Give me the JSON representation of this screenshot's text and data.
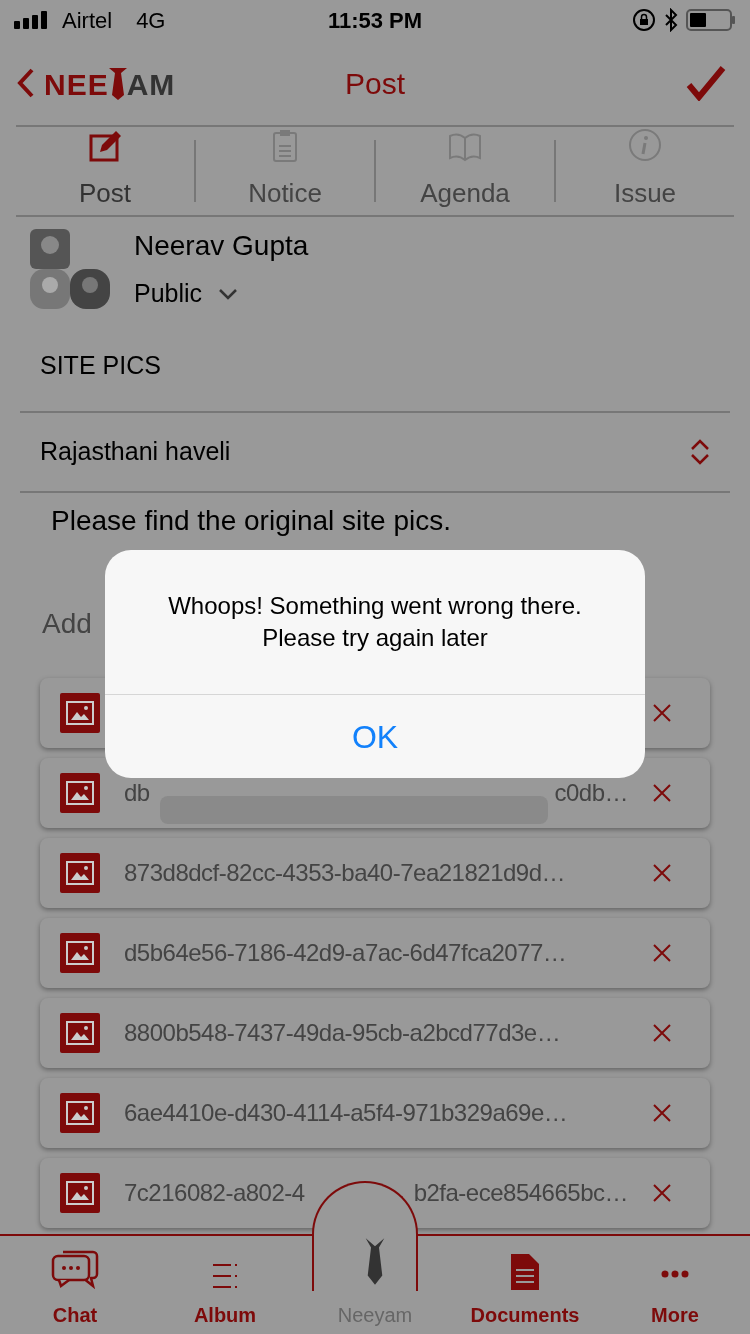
{
  "status_bar": {
    "carrier": "Airtel",
    "network": "4G",
    "time": "11:53 PM"
  },
  "nav": {
    "logo_left": "NEE",
    "logo_right": "AM",
    "title": "Post"
  },
  "tabs": [
    {
      "label": "Post",
      "selected": true,
      "kind": "edit"
    },
    {
      "label": "Notice",
      "selected": false,
      "kind": "clipboard"
    },
    {
      "label": "Agenda",
      "selected": false,
      "kind": "book"
    },
    {
      "label": "Issue",
      "selected": false,
      "kind": "info"
    }
  ],
  "author": {
    "name": "Neerav Gupta",
    "audience": "Public"
  },
  "album_title": "SITE PICS",
  "location": "Rajasthani haveli",
  "message": "Please find the original site pics.",
  "add_label": "Add",
  "attachments": [
    {
      "kind": "image"
    },
    {
      "kind": "image",
      "start": "db",
      "end": "c0db…"
    },
    {
      "kind": "image",
      "start": "873d8dcf-82cc-4353-ba40-7ea21821d9d…"
    },
    {
      "kind": "image",
      "start": "d5b64e56-7186-42d9-a7ac-6d47fca2077…"
    },
    {
      "kind": "image",
      "start": "8800b548-7437-49da-95cb-a2bcd77d3e…"
    },
    {
      "kind": "image",
      "start": "6ae4410e-d430-4114-a5f4-971b329a69e…"
    },
    {
      "kind": "image",
      "start": "7c216082-a802-4",
      "end": "b2fa-ece854665bc…"
    }
  ],
  "alert": {
    "message": [
      "Whoops! Something went wrong there.",
      "Please try again later"
    ],
    "button": "OK"
  },
  "bottom_nav": [
    {
      "label": "Chat",
      "kind": "chat"
    },
    {
      "label": "Album",
      "kind": "album"
    },
    {
      "label": "Neeyam",
      "kind": "center"
    },
    {
      "label": "Documents",
      "kind": "document"
    },
    {
      "label": "More",
      "kind": "more"
    }
  ]
}
